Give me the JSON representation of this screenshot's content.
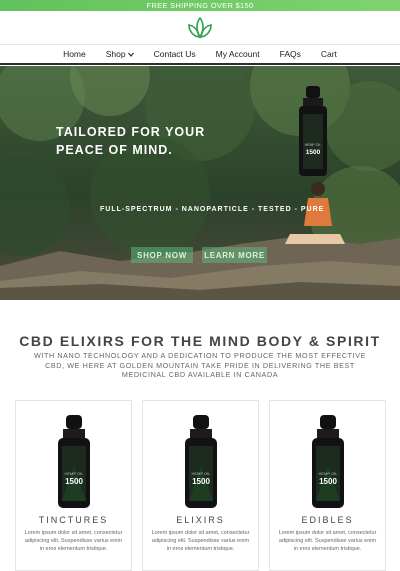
{
  "promo": {
    "text": "FREE SHIPPING OVER $150"
  },
  "logo": {
    "icon": "lotus-leaf-icon",
    "color": "#2f9e4d"
  },
  "nav": {
    "items": [
      {
        "label": "Home",
        "icon": null
      },
      {
        "label": "Shop",
        "icon": "chevron-down-icon"
      },
      {
        "label": "Contact Us",
        "icon": null
      },
      {
        "label": "My Account",
        "icon": null
      },
      {
        "label": "FAQs",
        "icon": null
      },
      {
        "label": "Cart",
        "icon": null
      }
    ]
  },
  "hero": {
    "title_line1": "TAILORED FOR YOUR",
    "title_line2": "PEACE OF MIND.",
    "subtitle": "FULL-SPECTRUM - NANOPARTICLE - TESTED - PURE",
    "shop_label": "SHOP NOW",
    "learn_label": "LEARN MORE",
    "bottle_label": "HEMP OIL",
    "bottle_strength": "1500"
  },
  "section": {
    "title": "CBD ELIXIRS FOR THE MIND BODY & SPIRIT",
    "description": "WITH NANO TECHNOLOGY AND A DEDICATION TO PRODUCE THE MOST EFFECTIVE CBD, WE HERE AT GOLDEN MOUNTAIN TAKE PRIDE IN DELIVERING THE BEST MEDICINAL CBD AVAILABLE IN CANADA"
  },
  "cards": [
    {
      "title": "TINCTURES",
      "text": "Lorem ipsum dolor sit amet, consectetur adipiscing elit. Suspendisse varius enim in eros elementum tristique."
    },
    {
      "title": "ELIXIRS",
      "text": "Lorem ipsum dolor sit amet, consectetur adipiscing elit. Suspendisse varius enim in eros elementum tristique."
    },
    {
      "title": "EDIBLES",
      "text": "Lorem ipsum dolor sit amet, consectetur adipiscing elit. Suspendisse varius enim in eros elementum tristique."
    }
  ],
  "colors": {
    "accent": "#62c25d",
    "button": "#5eb478"
  }
}
